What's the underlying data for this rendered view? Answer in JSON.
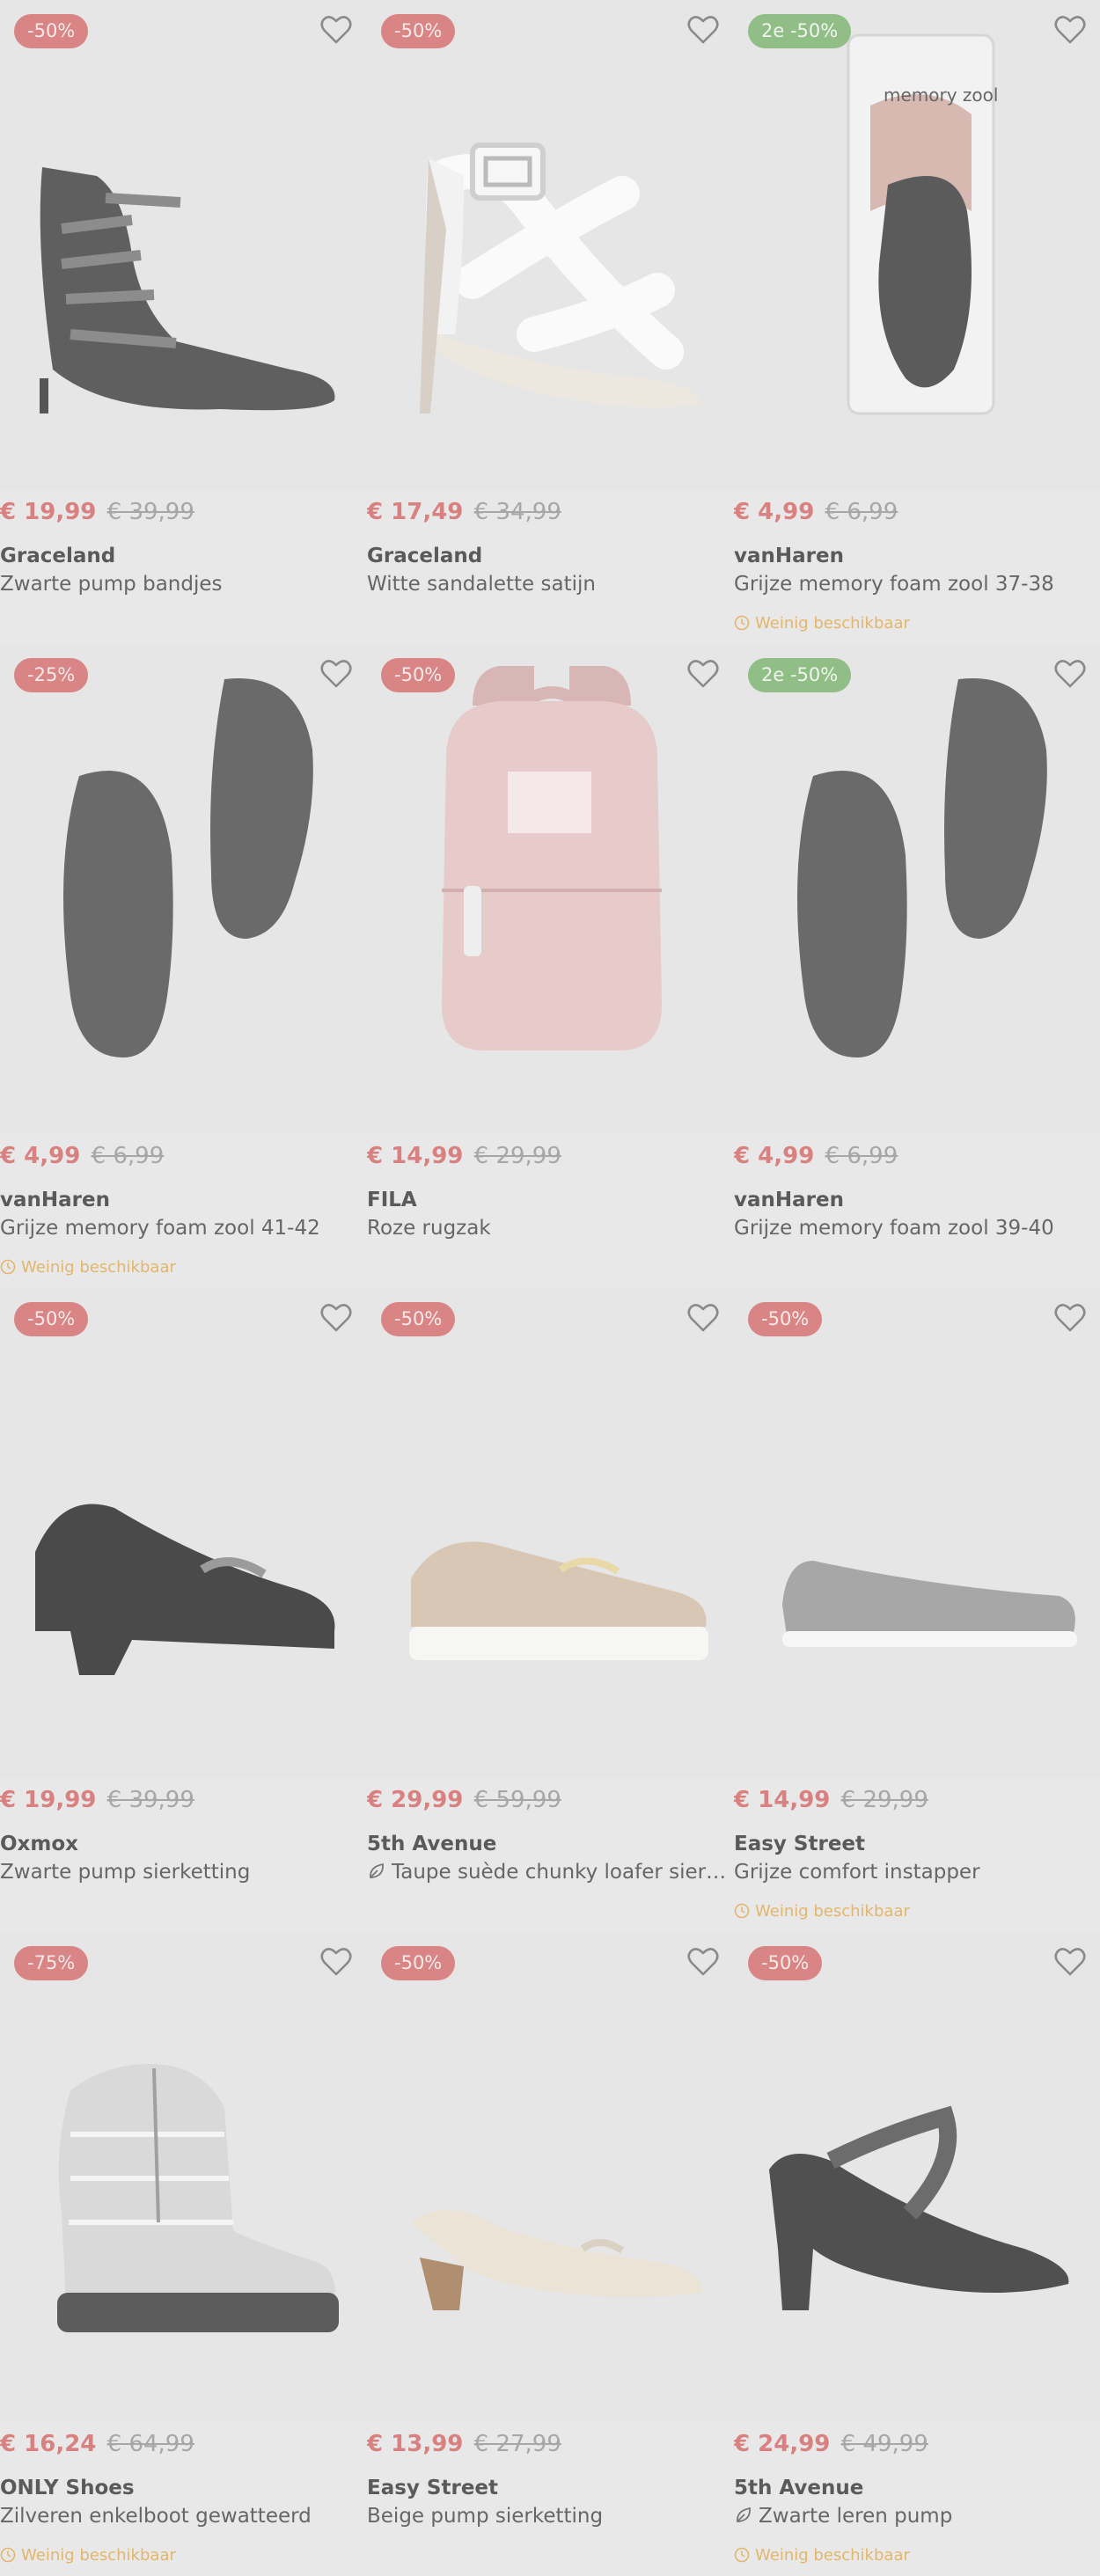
{
  "colors": {
    "discount_badge": "#d98585",
    "promo_badge": "#91bd86",
    "price_now": "#d98080",
    "price_old": "#a7a7a7",
    "stock_warning": "#e2b66c"
  },
  "products": [
    {
      "badge": "-50%",
      "badge_style": "discount",
      "product_icon": "stiletto-bandage-pump",
      "price_now": "€ 19,99",
      "price_old": "€ 39,99",
      "brand": "Graceland",
      "title": "Zwarte pump bandjes",
      "stock": ""
    },
    {
      "badge": "-50%",
      "badge_style": "discount",
      "product_icon": "white-heeled-sandal",
      "price_now": "€ 17,49",
      "price_old": "€ 34,99",
      "brand": "Graceland",
      "title": "Witte sandalette satijn",
      "stock": ""
    },
    {
      "badge": "2e -50%",
      "badge_style": "promo",
      "product_icon": "insole-package",
      "package_label": "memory zool",
      "price_now": "€ 4,99",
      "price_old": "€ 6,99",
      "brand": "vanHaren",
      "title": "Grijze memory foam zool 37-38",
      "stock": "Weinig beschikbaar"
    },
    {
      "badge": "-25%",
      "badge_style": "discount",
      "product_icon": "insoles",
      "price_now": "€ 4,99",
      "price_old": "€ 6,99",
      "brand": "vanHaren",
      "title": "Grijze memory foam zool 41-42",
      "stock": "Weinig beschikbaar"
    },
    {
      "badge": "-50%",
      "badge_style": "discount",
      "product_icon": "pink-backpack",
      "price_now": "€ 14,99",
      "price_old": "€ 29,99",
      "brand": "FILA",
      "title": "Roze rugzak",
      "stock": ""
    },
    {
      "badge": "2e -50%",
      "badge_style": "promo",
      "product_icon": "insoles",
      "price_now": "€ 4,99",
      "price_old": "€ 6,99",
      "brand": "vanHaren",
      "title": "Grijze memory foam zool 39-40",
      "stock": ""
    },
    {
      "badge": "-50%",
      "badge_style": "discount",
      "product_icon": "black-block-heel-loafer",
      "price_now": "€ 19,99",
      "price_old": "€ 39,99",
      "brand": "Oxmox",
      "title": "Zwarte pump sierketting",
      "stock": ""
    },
    {
      "badge": "-50%",
      "badge_style": "discount",
      "product_icon": "taupe-chunky-loafer",
      "price_now": "€ 29,99",
      "price_old": "€ 59,99",
      "brand": "5th Avenue",
      "title": "Taupe suède chunky loafer sierk...",
      "sustainable_icon": "leaf-icon",
      "stock": ""
    },
    {
      "badge": "-50%",
      "badge_style": "discount",
      "product_icon": "grey-knit-flat",
      "price_now": "€ 14,99",
      "price_old": "€ 29,99",
      "brand": "Easy Street",
      "title": "Grijze comfort instapper",
      "stock": "Weinig beschikbaar"
    },
    {
      "badge": "-75%",
      "badge_style": "discount",
      "product_icon": "silver-puffer-boot",
      "price_now": "€ 16,24",
      "price_old": "€ 64,99",
      "brand": "ONLY Shoes",
      "title": "Zilveren enkelboot gewatteerd",
      "stock": "Weinig beschikbaar"
    },
    {
      "badge": "-50%",
      "badge_style": "discount",
      "product_icon": "beige-low-pump",
      "price_now": "€ 13,99",
      "price_old": "€ 27,99",
      "brand": "Easy Street",
      "title": "Beige pump sierketting",
      "stock": ""
    },
    {
      "badge": "-50%",
      "badge_style": "discount",
      "product_icon": "black-strap-pump",
      "price_now": "€ 24,99",
      "price_old": "€ 49,99",
      "brand": "5th Avenue",
      "title": "Zwarte leren pump",
      "sustainable_icon": "leaf-icon",
      "stock": "Weinig beschikbaar"
    }
  ]
}
